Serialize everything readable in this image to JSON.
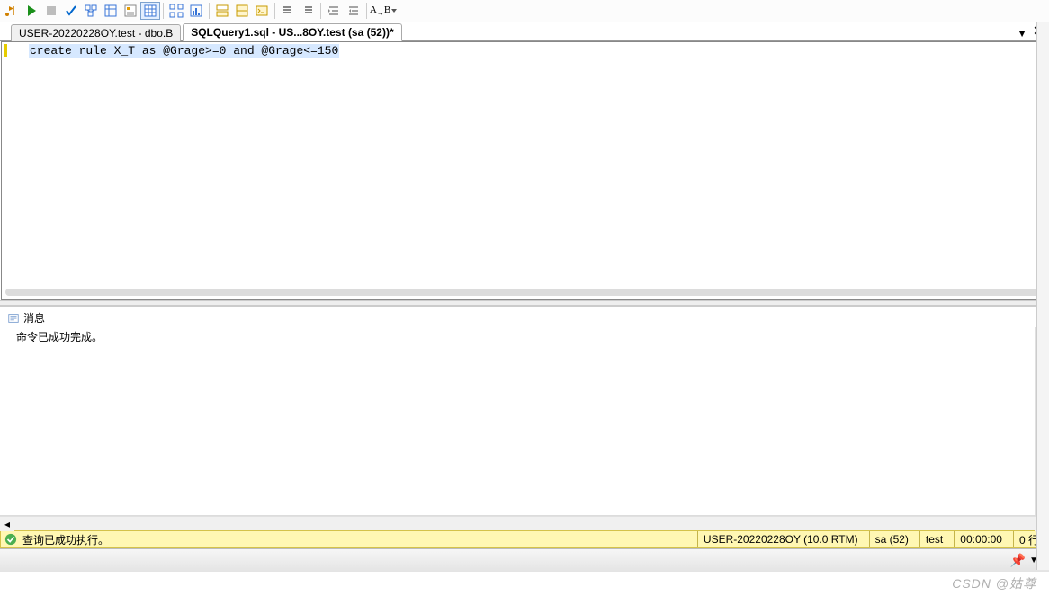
{
  "toolbar": {},
  "tabs": {
    "inactive": "USER-20220228OY.test - dbo.B",
    "active": "SQLQuery1.sql - US...8OY.test (sa (52))*"
  },
  "editor": {
    "sql_text": "create rule X_T as @Grage>=0 and @Grage<=150"
  },
  "messages": {
    "tab_label": "消息",
    "body_text": "命令已成功完成。"
  },
  "status": {
    "exec_text": "查询已成功执行。",
    "server": "USER-20220228OY (10.0 RTM)",
    "login": "sa (52)",
    "database": "test",
    "duration": "00:00:00",
    "rows": "0 行"
  },
  "watermark": "CSDN @姑尊"
}
